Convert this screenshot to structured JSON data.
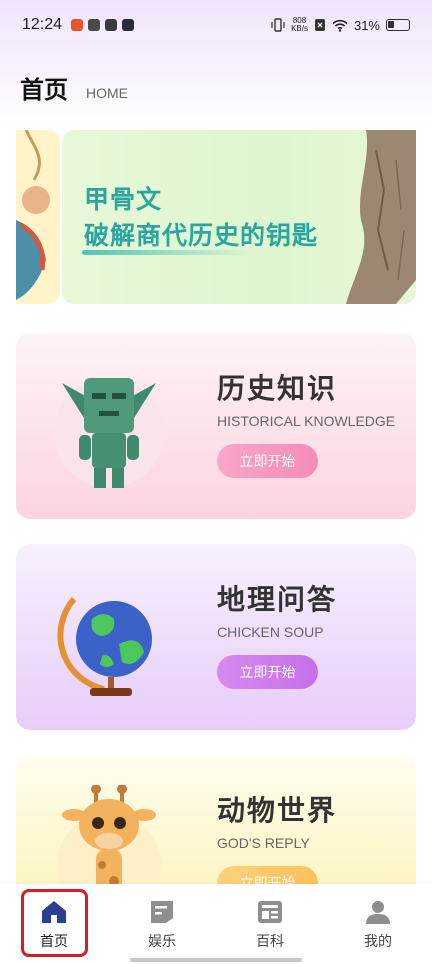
{
  "status_bar": {
    "time": "12:24",
    "net_speed_value": "808",
    "net_speed_unit": "KB/s",
    "battery": "31%"
  },
  "header": {
    "title": "首页",
    "subtitle": "HOME"
  },
  "banner": {
    "line1": "甲骨文",
    "line2": "破解商代历史的钥匙"
  },
  "cards": [
    {
      "title": "历史知识",
      "subtitle": "HISTORICAL KNOWLEDGE",
      "button": "立即开始",
      "icon": "bronze-mask-figure"
    },
    {
      "title": "地理问答",
      "subtitle": "CHICKEN SOUP",
      "button": "立即开始",
      "icon": "globe"
    },
    {
      "title": "动物世界",
      "subtitle": "GOD'S REPLY",
      "button": "立即开始",
      "icon": "giraffe"
    }
  ],
  "bottom_nav": [
    {
      "label": "首页",
      "icon": "home-icon",
      "active": true
    },
    {
      "label": "娱乐",
      "icon": "entertainment-icon",
      "active": false
    },
    {
      "label": "百科",
      "icon": "encyclopedia-icon",
      "active": false
    },
    {
      "label": "我的",
      "icon": "profile-icon",
      "active": false
    }
  ],
  "colors": {
    "banner_text": "#2aa5a0",
    "history_button": "#f58bb8",
    "geo_button": "#c56fea",
    "animal_button": "#fbc15a",
    "nav_highlight": "#d21e2a",
    "nav_home_icon": "#2c3e8f"
  }
}
